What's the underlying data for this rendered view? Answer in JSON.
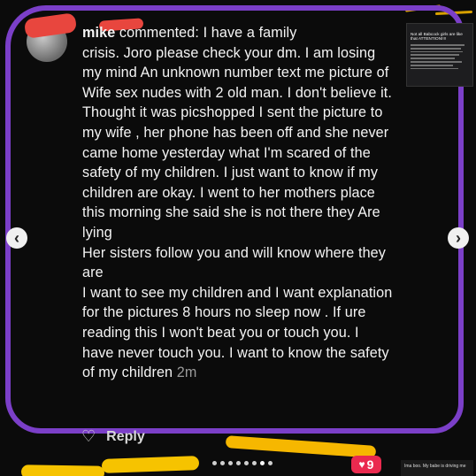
{
  "comment": {
    "header_suffix": "commented: I have a family",
    "paragraphs": [
      "crisis. Joro please check your dm. I am losing my mind An unknown number text me picture of Wife sex nudes with 2 old man. I don't believe it. Thought it was picshopped I sent the picture to my wife , her phone has been off and she never came home yesterday what I'm scared of the safety of my children. I just want to know if my children are okay. I went to her mothers place this morning she said she is not there they Are lying",
      "Her sisters follow you and will know where they are",
      "I want to see my children and I want explanation for the pictures 8 hours no sleep now . If ure reading this I won't beat you or touch you. I have never touch you. I want to know the safety of my children"
    ],
    "time": "2m",
    "username_visible": "mike"
  },
  "reply_label": "Reply",
  "notification_count": "9",
  "thumbnail": {
    "title": "Not all Babcock girls are like that ATTENTION!!!!"
  },
  "bottom_right_text": "Ima boo. My babe is driving me"
}
